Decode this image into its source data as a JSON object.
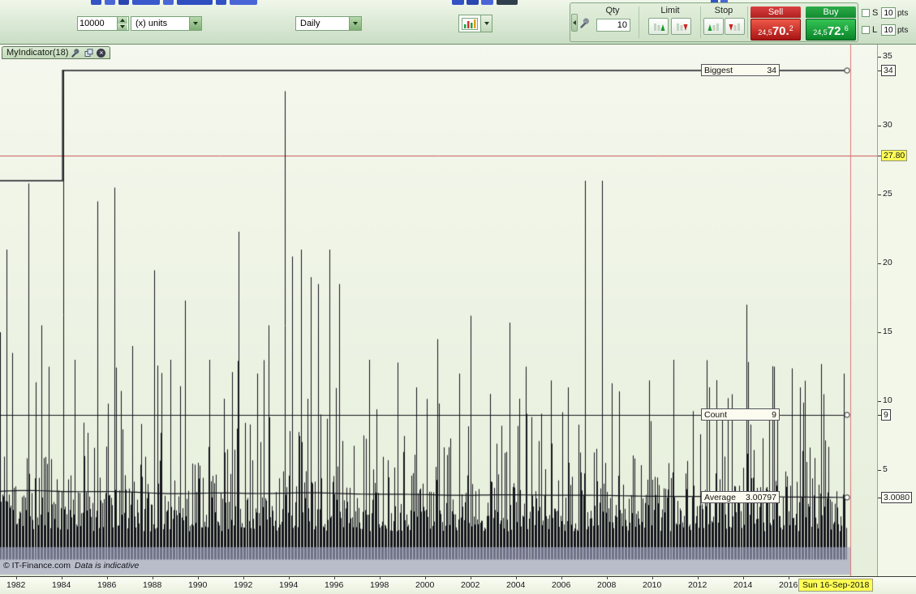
{
  "toolbar": {
    "quantity": {
      "value": "10000",
      "units": "(x) units"
    },
    "timeframe": "Daily",
    "trade": {
      "qty_label": "Qty",
      "qty_value": "10",
      "limit_label": "Limit",
      "stop_label": "Stop",
      "sell_label": "Sell",
      "buy_label": "Buy",
      "sell_price_prefix": "24,5",
      "sell_price_main": "70.",
      "sell_price_sup": "2",
      "buy_price_prefix": "24,5",
      "buy_price_main": "72.",
      "buy_price_sup": "6",
      "short_label": "S",
      "long_label": "L",
      "short_pts": "10",
      "long_pts": "10",
      "pts_label": "pts"
    }
  },
  "indicator": {
    "name": "MyIndicator(18)"
  },
  "chart_data": {
    "type": "bar",
    "title": "MyIndicator(18)",
    "timeframe": "Daily",
    "x_years": [
      1982,
      1984,
      1986,
      1988,
      1990,
      1992,
      1994,
      1996,
      1998,
      2000,
      2002,
      2004,
      2006,
      2008,
      2010,
      2012,
      2014,
      2016
    ],
    "current_date_label": "Sun 16-Sep-2018",
    "x_range": [
      1981.3,
      2018.7
    ],
    "ylim": [
      -2.7,
      35.9
    ],
    "grid": false,
    "y_axis_labels": [
      {
        "value": 35,
        "label": "35",
        "style": "plain"
      },
      {
        "value": 34,
        "label": "34",
        "style": "boxed"
      },
      {
        "value": 30,
        "label": "30",
        "style": "plain"
      },
      {
        "value": 27.8,
        "label": "27.80",
        "style": "yellow"
      },
      {
        "value": 25,
        "label": "25",
        "style": "plain"
      },
      {
        "value": 20,
        "label": "20",
        "style": "plain"
      },
      {
        "value": 15,
        "label": "15",
        "style": "plain"
      },
      {
        "value": 10,
        "label": "10",
        "style": "plain"
      },
      {
        "value": 9,
        "label": "9",
        "style": "boxed"
      },
      {
        "value": 5,
        "label": "5",
        "style": "plain"
      },
      {
        "value": 3.008,
        "label": "3.0080",
        "style": "boxed"
      }
    ],
    "price_level": {
      "value": 27.8,
      "label": "27.80"
    },
    "overlays": [
      {
        "id": "biggest",
        "label": "Biggest",
        "value": 34,
        "display": "34",
        "pre_value": 26,
        "jump_year": 1984.04,
        "shape": "step-line"
      },
      {
        "id": "count",
        "label": "Count",
        "value": 9,
        "display": "9",
        "shape": "horizontal-line"
      },
      {
        "id": "average",
        "label": "Average",
        "value": 3.00797,
        "display": "3.00797",
        "start_value": 3.45,
        "shape": "trend-line"
      }
    ],
    "band": {
      "top_value": -0.6,
      "bottom_value": -2.6
    },
    "bars": {
      "count": 780,
      "seed": 11,
      "base": 0.55,
      "tail_scale": 2.85,
      "clip": 13.5,
      "floor": -1.5
    },
    "notable_spikes": [
      [
        1981.3,
        15
      ],
      [
        1981.57,
        21
      ],
      [
        1981.8,
        13.5
      ],
      [
        1982.54,
        25.8
      ],
      [
        1983.1,
        15.5
      ],
      [
        1983.45,
        12.5
      ],
      [
        1984.04,
        34
      ],
      [
        1984.6,
        13
      ],
      [
        1985.57,
        24.5
      ],
      [
        1986.29,
        25.5
      ],
      [
        1987.1,
        14
      ],
      [
        1988.07,
        19.5
      ],
      [
        1988.8,
        13
      ],
      [
        1989.39,
        17.3
      ],
      [
        1990.5,
        13
      ],
      [
        1991.82,
        22.3
      ],
      [
        1992.6,
        12
      ],
      [
        1993.1,
        15.5
      ],
      [
        1993.8,
        32.5
      ],
      [
        1994.15,
        20.5
      ],
      [
        1994.55,
        21
      ],
      [
        1994.95,
        19
      ],
      [
        1995.3,
        18.5
      ],
      [
        1995.75,
        21
      ],
      [
        1996.2,
        18.5
      ],
      [
        1997.54,
        13
      ],
      [
        1998.79,
        12.8
      ],
      [
        1999.6,
        11
      ],
      [
        2000.57,
        14.5
      ],
      [
        2001.5,
        12
      ],
      [
        2002.0,
        16.2
      ],
      [
        2003.71,
        15.7
      ],
      [
        2004.43,
        12.5
      ],
      [
        2005.5,
        11.5
      ],
      [
        2006.3,
        11
      ],
      [
        2007.07,
        26
      ],
      [
        2007.79,
        26
      ],
      [
        2009.86,
        11.5
      ],
      [
        2010.93,
        13
      ],
      [
        2012.5,
        11
      ],
      [
        2013.5,
        10.5
      ],
      [
        2014.14,
        17
      ],
      [
        2015.39,
        12.5
      ],
      [
        2016.5,
        11
      ],
      [
        2017.5,
        10.5
      ],
      [
        2018.43,
        12
      ]
    ],
    "colors": {
      "bar": "#14141c",
      "band": "#9fa3c0",
      "price_line": "#cc5555",
      "cursor_line": "#dd7777",
      "plot_top": "#f5f8ee",
      "plot_bottom": "#e6efdb"
    }
  },
  "footer": {
    "copyright": "© IT-Finance.com",
    "note": "Data is indicative"
  }
}
